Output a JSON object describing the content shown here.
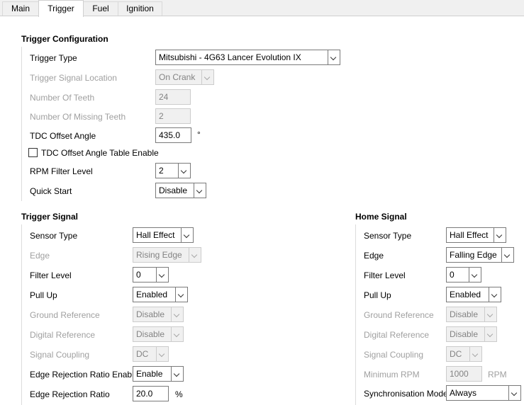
{
  "tabs": [
    {
      "label": "Main",
      "active": false
    },
    {
      "label": "Trigger",
      "active": true
    },
    {
      "label": "Fuel",
      "active": false
    },
    {
      "label": "Ignition",
      "active": false
    }
  ],
  "trigger_configuration": {
    "title": "Trigger Configuration",
    "trigger_type": {
      "label": "Trigger Type",
      "value": "Mitsubishi - 4G63 Lancer Evolution IX"
    },
    "trigger_signal_location": {
      "label": "Trigger Signal Location",
      "value": "On Crank"
    },
    "number_of_teeth": {
      "label": "Number Of Teeth",
      "value": "24"
    },
    "number_of_missing_teeth": {
      "label": "Number Of Missing Teeth",
      "value": "2"
    },
    "tdc_offset_angle": {
      "label": "TDC Offset Angle",
      "value": "435.0",
      "unit": "°"
    },
    "tdc_offset_table_enable": {
      "label": "TDC Offset Angle Table Enable",
      "checked": false
    },
    "rpm_filter_level": {
      "label": "RPM Filter Level",
      "value": "2"
    },
    "quick_start": {
      "label": "Quick Start",
      "value": "Disable"
    }
  },
  "trigger_signal": {
    "title": "Trigger Signal",
    "sensor_type": {
      "label": "Sensor Type",
      "value": "Hall Effect"
    },
    "edge": {
      "label": "Edge",
      "value": "Rising Edge"
    },
    "filter_level": {
      "label": "Filter Level",
      "value": "0"
    },
    "pull_up": {
      "label": "Pull Up",
      "value": "Enabled"
    },
    "ground_reference": {
      "label": "Ground Reference",
      "value": "Disable"
    },
    "digital_reference": {
      "label": "Digital Reference",
      "value": "Disable"
    },
    "signal_coupling": {
      "label": "Signal Coupling",
      "value": "DC"
    },
    "edge_rejection_ratio_enable": {
      "label": "Edge Rejection Ratio Enable",
      "value": "Enable"
    },
    "edge_rejection_ratio": {
      "label": "Edge Rejection Ratio",
      "value": "20.0",
      "unit": "%"
    }
  },
  "home_signal": {
    "title": "Home Signal",
    "sensor_type": {
      "label": "Sensor Type",
      "value": "Hall Effect"
    },
    "edge": {
      "label": "Edge",
      "value": "Falling Edge"
    },
    "filter_level": {
      "label": "Filter Level",
      "value": "0"
    },
    "pull_up": {
      "label": "Pull Up",
      "value": "Enabled"
    },
    "ground_reference": {
      "label": "Ground Reference",
      "value": "Disable"
    },
    "digital_reference": {
      "label": "Digital Reference",
      "value": "Disable"
    },
    "signal_coupling": {
      "label": "Signal Coupling",
      "value": "DC"
    },
    "minimum_rpm": {
      "label": "Minimum RPM",
      "value": "1000",
      "unit": "RPM"
    },
    "synchronisation_mode": {
      "label": "Synchronisation Mode",
      "value": "Always"
    }
  }
}
